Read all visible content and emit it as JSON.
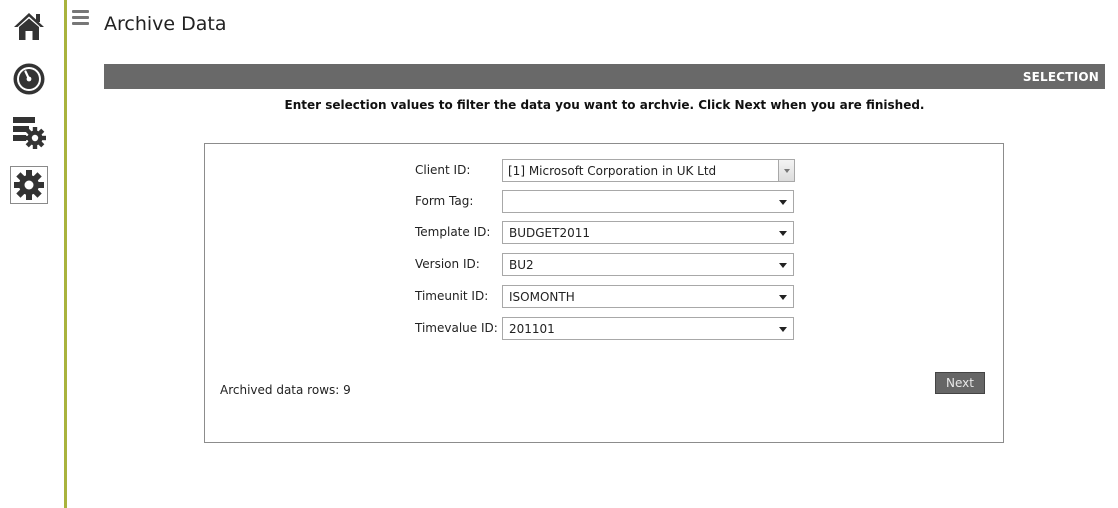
{
  "app": {
    "nav": [
      {
        "name": "home",
        "icon": "home-icon"
      },
      {
        "name": "dashboard",
        "icon": "gauge-icon"
      },
      {
        "name": "data-settings",
        "icon": "server-gear-icon"
      },
      {
        "name": "settings",
        "icon": "gear-icon",
        "active": true
      }
    ],
    "menu_icon": "hamburger-icon",
    "accent_color": "#a9b33d"
  },
  "page": {
    "title": "Archive Data",
    "section": "SELECTION",
    "instructions": "Enter selection values to filter the data you want to archvie. Click Next when you are finished."
  },
  "form": {
    "client_id": {
      "label": "Client ID:",
      "value": "[1] Microsoft Corporation in UK Ltd"
    },
    "form_tag": {
      "label": "Form Tag:",
      "value": ""
    },
    "template_id": {
      "label": "Template ID:",
      "value": "BUDGET2011"
    },
    "version_id": {
      "label": "Version ID:",
      "value": "BU2"
    },
    "timeunit_id": {
      "label": "Timeunit ID:",
      "value": "ISOMONTH"
    },
    "timevalue_id": {
      "label": "Timevalue ID:",
      "value": "201101"
    }
  },
  "footer": {
    "archived_rows": "Archived data rows: 9",
    "next_label": "Next"
  }
}
